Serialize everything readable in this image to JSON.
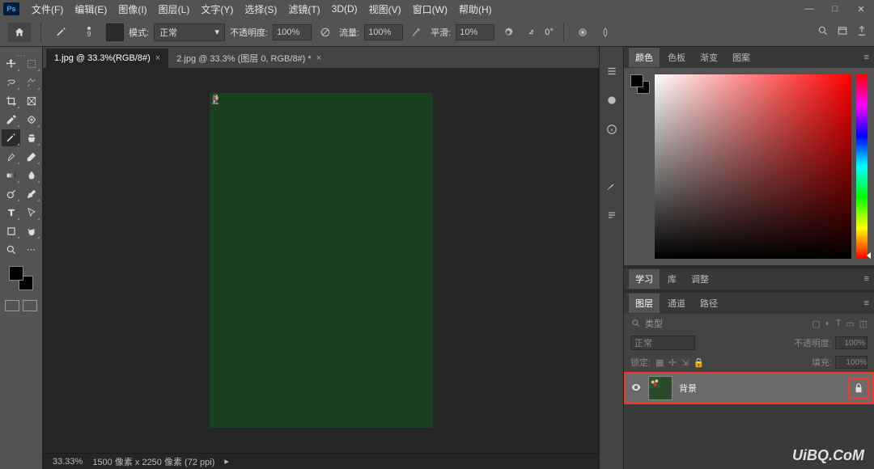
{
  "menubar": {
    "items": [
      "文件(F)",
      "编辑(E)",
      "图像(I)",
      "图层(L)",
      "文字(Y)",
      "选择(S)",
      "滤镜(T)",
      "3D(D)",
      "视图(V)",
      "窗口(W)",
      "帮助(H)"
    ]
  },
  "optionsbar": {
    "brush_size": "9",
    "mode_label": "模式:",
    "mode_value": "正常",
    "opacity_label": "不透明度:",
    "opacity_value": "100%",
    "flow_label": "流量:",
    "flow_value": "100%",
    "smooth_label": "平滑:",
    "smooth_value": "10%",
    "angle_label": "0°"
  },
  "tabs": [
    {
      "label": "1.jpg @ 33.3%(RGB/8#)",
      "active": true
    },
    {
      "label": "2.jpg @ 33.3% (图层 0, RGB/8#) *",
      "active": false
    }
  ],
  "statusbar": {
    "zoom": "33.33%",
    "dims": "1500 像素 x 2250 像素 (72 ppi)"
  },
  "color_panel": {
    "tabs": [
      "颜色",
      "色板",
      "渐变",
      "图案"
    ],
    "active": 0
  },
  "mid_panel": {
    "tabs": [
      "学习",
      "库",
      "调整"
    ],
    "active": 0
  },
  "layers_panel": {
    "tabs": [
      "图层",
      "通道",
      "路径"
    ],
    "active": 0,
    "filter_label": "类型",
    "blend_mode": "正常",
    "opacity_label": "不透明度:",
    "opacity_value": "100%",
    "lock_label": "锁定:",
    "fill_label": "填充:",
    "fill_value": "100%",
    "layer": {
      "name": "背景"
    }
  },
  "watermark": "UiBQ.CoM"
}
